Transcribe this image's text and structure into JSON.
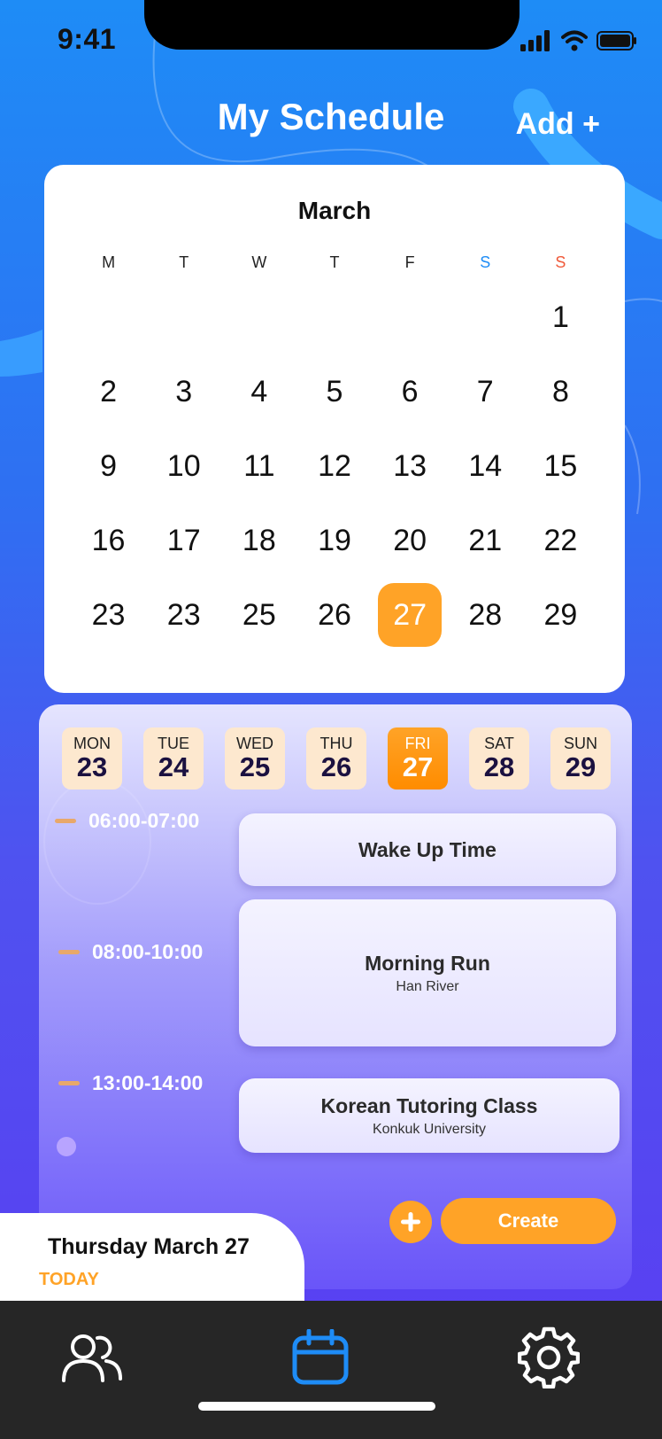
{
  "status_bar": {
    "time": "9:41"
  },
  "header": {
    "title": "My Schedule",
    "add_label": "Add +"
  },
  "calendar": {
    "month": "March",
    "weekdays": [
      "M",
      "T",
      "W",
      "T",
      "F",
      "S",
      "S"
    ],
    "weekday_colors": [
      "#222222",
      "#222222",
      "#222222",
      "#222222",
      "#222222",
      "#1e8cf6",
      "#f05a3a"
    ],
    "days": [
      "",
      "",
      "",
      "",
      "",
      "",
      "1",
      "2",
      "3",
      "4",
      "5",
      "6",
      "7",
      "8",
      "9",
      "10",
      "11",
      "12",
      "13",
      "14",
      "15",
      "16",
      "17",
      "18",
      "19",
      "20",
      "21",
      "22",
      "23",
      "23",
      "25",
      "26",
      "27",
      "28",
      "29"
    ],
    "selected_day": "27"
  },
  "week_strip": [
    {
      "name": "MON",
      "date": "23"
    },
    {
      "name": "TUE",
      "date": "24"
    },
    {
      "name": "WED",
      "date": "25"
    },
    {
      "name": "THU",
      "date": "26"
    },
    {
      "name": "FRI",
      "date": "27",
      "active": true
    },
    {
      "name": "SAT",
      "date": "28"
    },
    {
      "name": "SUN",
      "date": "29"
    }
  ],
  "events": [
    {
      "time": "06:00-07:00",
      "title": "Wake Up Time",
      "subtitle": ""
    },
    {
      "time": "08:00-10:00",
      "title": "Morning Run",
      "subtitle": "Han River"
    },
    {
      "time": "13:00-14:00",
      "title": "Korean Tutoring Class",
      "subtitle": "Konkuk University"
    }
  ],
  "actions": {
    "create_label": "Create"
  },
  "today": {
    "date": "Thursday March 27",
    "label": "TODAY"
  },
  "tabs": [
    {
      "icon": "people-icon"
    },
    {
      "icon": "calendar-icon",
      "active": true
    },
    {
      "icon": "gear-icon"
    }
  ],
  "colors": {
    "accent": "#ffa327",
    "active_tab": "#1e8cf6",
    "tab_bar": "#262626"
  }
}
